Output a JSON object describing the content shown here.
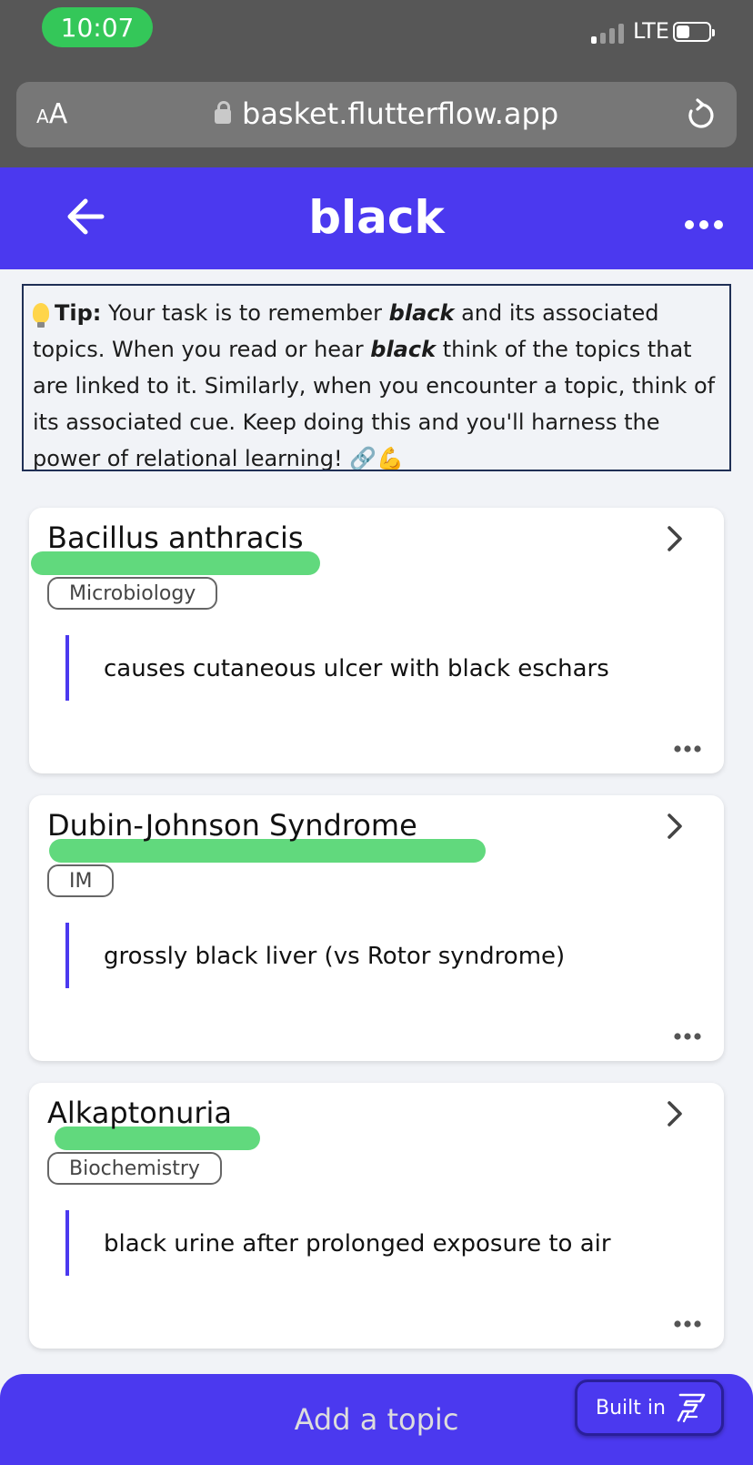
{
  "status": {
    "time": "10:07",
    "network": "LTE"
  },
  "browser": {
    "aa_label_small": "A",
    "aa_label_big": "A",
    "url": "basket.flutterflow.app"
  },
  "header": {
    "title": "black"
  },
  "tip": {
    "label": "Tip:",
    "t1": " Your task is to remember ",
    "cue1": "black",
    "t2": " and its associated topics. When you read or hear ",
    "cue2": "black",
    "t3": " think of the topics that are linked to it. Similarly, when you encounter a topic, think of its associated cue. Keep doing this and you'll harness the power of relational learning! ",
    "emoji": "🔗💪"
  },
  "cards": [
    {
      "title": "Bacillus anthracis",
      "tag": "Microbiology",
      "description": "causes cutaneous ulcer with black eschars"
    },
    {
      "title": "Dubin-Johnson Syndrome",
      "tag": "IM",
      "description": "grossly black liver (vs Rotor syndrome)"
    },
    {
      "title": "Alkaptonuria",
      "tag": "Biochemistry",
      "description": "black urine after prolonged exposure to air"
    }
  ],
  "footer": {
    "add_label": "Add a topic",
    "built_in_label": "Built in"
  },
  "colors": {
    "primary": "#4b39ef",
    "highlight": "#54d672",
    "status_green": "#34c759"
  }
}
